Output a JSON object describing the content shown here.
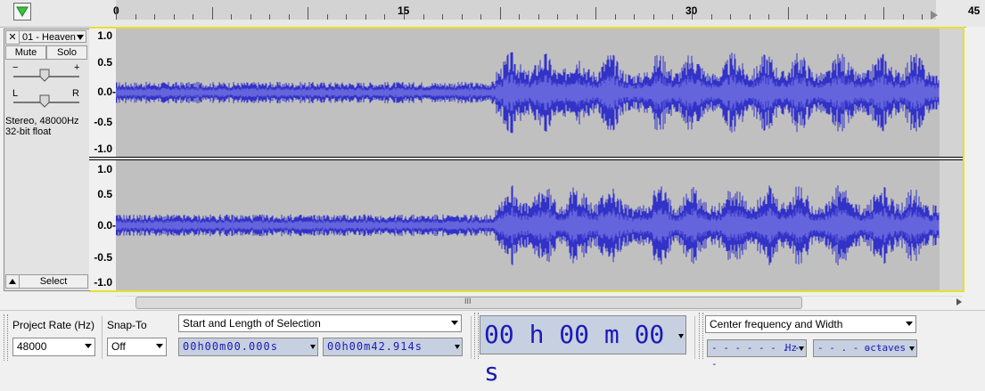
{
  "ruler": {
    "ticks": [
      "0",
      "15",
      "30",
      "45"
    ]
  },
  "track": {
    "name": "01 - Heaven",
    "close_glyph": "✕",
    "mute_label": "Mute",
    "solo_label": "Solo",
    "gain_minus": "−",
    "gain_plus": "+",
    "pan_left": "L",
    "pan_right": "R",
    "info_line1": "Stereo, 48000Hz",
    "info_line2": "32-bit float",
    "select_label": "Select",
    "yaxis_labels": [
      "1.0",
      "0.5",
      "0.0-",
      "-0.5",
      "-1.0"
    ]
  },
  "scrollbar": {
    "grip": "III"
  },
  "toolbar": {
    "project_rate_label": "Project Rate (Hz)",
    "project_rate_value": "48000",
    "snap_to_label": "Snap-To",
    "snap_to_value": "Off",
    "selection_mode": "Start and Length of Selection",
    "start_time": "00h00m00.000s",
    "length_time": "00h00m42.914s",
    "big_time": "00 h 00 m 00 s",
    "spectral_mode": "Center frequency and Width",
    "freq_value": "- - - - - - . - -",
    "freq_unit": "Hz",
    "width_value": "- - . - - -",
    "width_unit": "octaves"
  },
  "colors": {
    "wave": "#3232c8",
    "wave_rms": "#6464dc",
    "selection_border": "#e7e02f"
  }
}
